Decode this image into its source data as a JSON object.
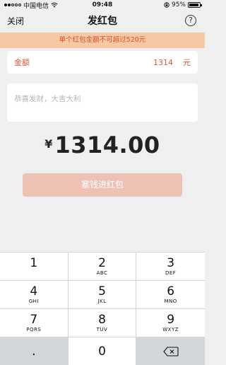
{
  "status_bar": {
    "carrier": "中国电信",
    "time": "09:48",
    "battery_percent": "95%",
    "battery_level": 0.95
  },
  "nav": {
    "close_label": "关闭",
    "title": "发红包",
    "help_glyph": "?"
  },
  "warning": {
    "text": "单个红包金额不可超过520元"
  },
  "amount": {
    "label": "金额",
    "value": "1314",
    "unit": "元"
  },
  "message": {
    "placeholder": "恭喜发财，大吉大利",
    "value": ""
  },
  "total": {
    "currency_symbol": "¥",
    "amount": "1314.00"
  },
  "submit": {
    "label": "塞钱进红包"
  },
  "keypad": {
    "keys": [
      {
        "digit": "1",
        "letters": ""
      },
      {
        "digit": "2",
        "letters": "ABC"
      },
      {
        "digit": "3",
        "letters": "DEF"
      },
      {
        "digit": "4",
        "letters": "GHI"
      },
      {
        "digit": "5",
        "letters": "JKL"
      },
      {
        "digit": "6",
        "letters": "MNO"
      },
      {
        "digit": "7",
        "letters": "PQRS"
      },
      {
        "digit": "8",
        "letters": "TUV"
      },
      {
        "digit": "9",
        "letters": "WXYZ"
      }
    ],
    "dot": ".",
    "zero": "0",
    "backspace_icon": "backspace-icon"
  },
  "colors": {
    "accent": "#d65a3c",
    "warning_bg": "#f5c9a4",
    "button_disabled": "#edc2b5"
  }
}
